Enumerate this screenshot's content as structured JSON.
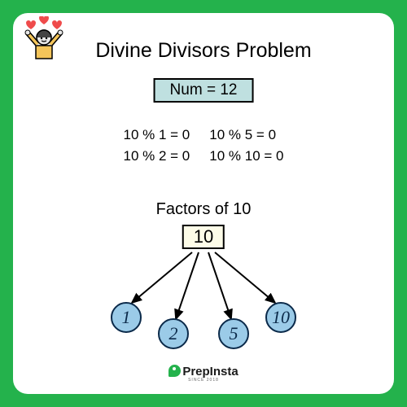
{
  "title": "Divine Divisors Problem",
  "numbox": "Num = 12",
  "equations": {
    "left": [
      "10 % 1 = 0",
      "10 % 2 = 0"
    ],
    "right": [
      "10 % 5 = 0",
      "10 % 10 = 0"
    ]
  },
  "factors_title": "Factors of 10",
  "root_node": "10",
  "factors": [
    "1",
    "2",
    "5",
    "10"
  ],
  "brand": {
    "name": "PrepInsta",
    "tagline": "SINCE 2018"
  },
  "icons": {
    "mascot": "happy-person-hearts"
  },
  "chart_data": {
    "type": "tree",
    "root": 10,
    "children": [
      1,
      2,
      5,
      10
    ],
    "annotations": [
      "10 % 1 = 0",
      "10 % 2 = 0",
      "10 % 5 = 0",
      "10 % 10 = 0"
    ]
  }
}
